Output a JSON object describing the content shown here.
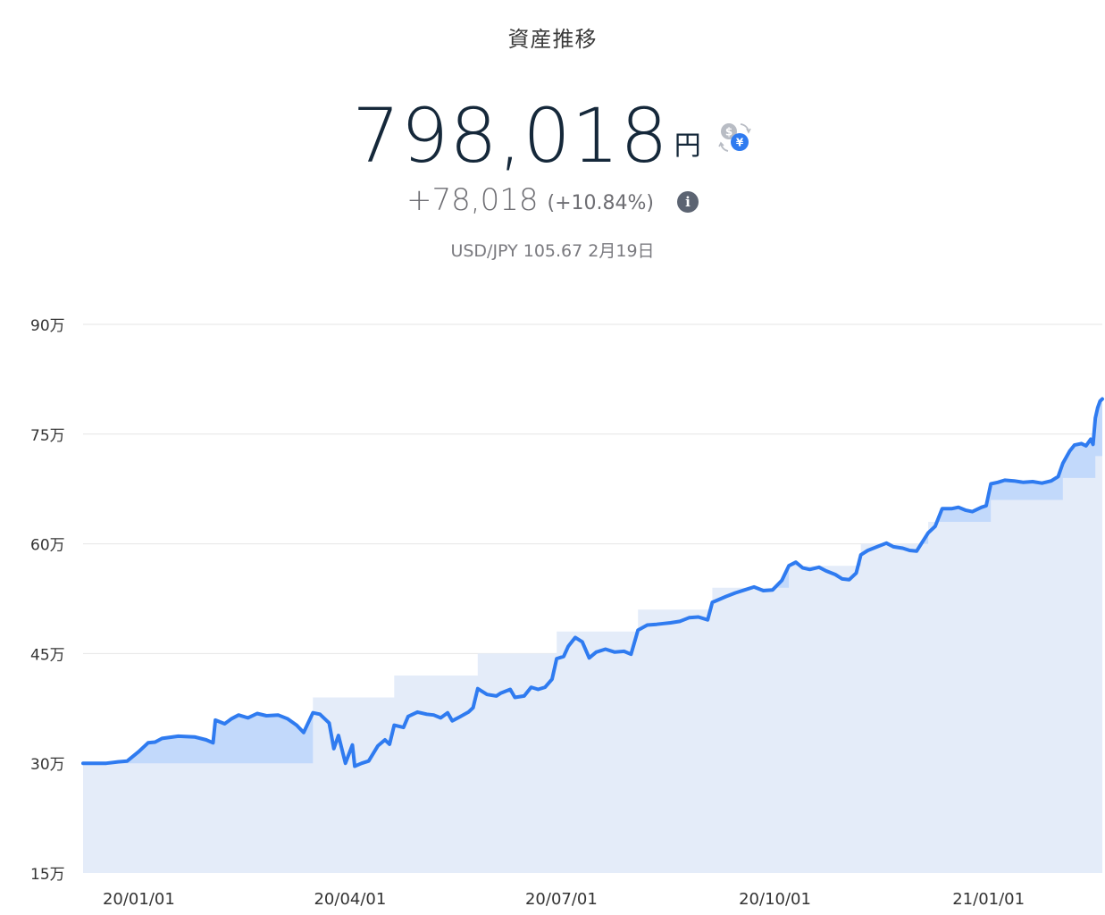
{
  "header": {
    "title": "資産推移",
    "total_value": "798,018",
    "total_unit": "円",
    "change_value": "+78,018",
    "change_percent": "(+10.84%)",
    "rate_text": "USD/JPY 105.67 2月19日",
    "currency_switch_symbols": [
      "$",
      "¥"
    ]
  },
  "colors": {
    "line": "#2f7bf0",
    "asset_fill": "#c2d9fb",
    "principal_fill": "#e4ecf9",
    "grid": "#e6e6e6"
  },
  "chart_data": {
    "type": "area",
    "y_unit": "万",
    "ylim": [
      15,
      90
    ],
    "y_ticks": [
      "15万",
      "30万",
      "45万",
      "60万",
      "75万",
      "90万"
    ],
    "y_tick_values": [
      15,
      30,
      45,
      60,
      75,
      90
    ],
    "x_ticks": [
      "20/01/01",
      "20/04/01",
      "20/07/01",
      "20/10/01",
      "21/01/01"
    ],
    "x_tick_dates": [
      "2020-01-01",
      "2020-04-01",
      "2020-07-01",
      "2020-10-01",
      "2021-01-01"
    ],
    "xlim": [
      "2019-12-08",
      "2021-02-19"
    ],
    "grid": true,
    "legend": "none",
    "series": [
      {
        "role": "asset",
        "points": [
          [
            "2019-12-08",
            30.0
          ],
          [
            "2019-12-18",
            30.0
          ],
          [
            "2019-12-23",
            30.2
          ],
          [
            "2019-12-27",
            30.3
          ],
          [
            "2020-01-01",
            31.6
          ],
          [
            "2020-01-05",
            32.8
          ],
          [
            "2020-01-08",
            32.9
          ],
          [
            "2020-01-11",
            33.4
          ],
          [
            "2020-01-18",
            33.7
          ],
          [
            "2020-01-25",
            33.6
          ],
          [
            "2020-01-30",
            33.2
          ],
          [
            "2020-02-02",
            32.8
          ],
          [
            "2020-02-03",
            35.9
          ],
          [
            "2020-02-07",
            35.4
          ],
          [
            "2020-02-10",
            36.1
          ],
          [
            "2020-02-13",
            36.6
          ],
          [
            "2020-02-17",
            36.2
          ],
          [
            "2020-02-21",
            36.8
          ],
          [
            "2020-02-25",
            36.5
          ],
          [
            "2020-03-01",
            36.6
          ],
          [
            "2020-03-05",
            36.1
          ],
          [
            "2020-03-09",
            35.2
          ],
          [
            "2020-03-12",
            34.2
          ],
          [
            "2020-03-16",
            36.9
          ],
          [
            "2020-03-19",
            36.7
          ],
          [
            "2020-03-23",
            35.5
          ],
          [
            "2020-03-25",
            32.0
          ],
          [
            "2020-03-27",
            33.8
          ],
          [
            "2020-03-30",
            30.0
          ],
          [
            "2020-04-02",
            32.5
          ],
          [
            "2020-04-03",
            29.6
          ],
          [
            "2020-04-06",
            30.0
          ],
          [
            "2020-04-09",
            30.3
          ],
          [
            "2020-04-13",
            32.4
          ],
          [
            "2020-04-16",
            33.2
          ],
          [
            "2020-04-18",
            32.6
          ],
          [
            "2020-04-20",
            35.2
          ],
          [
            "2020-04-24",
            34.9
          ],
          [
            "2020-04-26",
            36.4
          ],
          [
            "2020-04-30",
            37.0
          ],
          [
            "2020-05-04",
            36.7
          ],
          [
            "2020-05-07",
            36.6
          ],
          [
            "2020-05-10",
            36.2
          ],
          [
            "2020-05-13",
            36.9
          ],
          [
            "2020-05-15",
            35.8
          ],
          [
            "2020-05-18",
            36.3
          ],
          [
            "2020-05-22",
            37.0
          ],
          [
            "2020-05-24",
            37.6
          ],
          [
            "2020-05-26",
            40.2
          ],
          [
            "2020-05-30",
            39.4
          ],
          [
            "2020-06-03",
            39.2
          ],
          [
            "2020-06-05",
            39.6
          ],
          [
            "2020-06-09",
            40.1
          ],
          [
            "2020-06-11",
            39.0
          ],
          [
            "2020-06-15",
            39.2
          ],
          [
            "2020-06-18",
            40.4
          ],
          [
            "2020-06-21",
            40.1
          ],
          [
            "2020-06-24",
            40.4
          ],
          [
            "2020-06-27",
            41.5
          ],
          [
            "2020-06-29",
            44.3
          ],
          [
            "2020-07-02",
            44.6
          ],
          [
            "2020-07-04",
            46.0
          ],
          [
            "2020-07-07",
            47.2
          ],
          [
            "2020-07-10",
            46.6
          ],
          [
            "2020-07-13",
            44.4
          ],
          [
            "2020-07-16",
            45.2
          ],
          [
            "2020-07-20",
            45.6
          ],
          [
            "2020-07-24",
            45.2
          ],
          [
            "2020-07-28",
            45.3
          ],
          [
            "2020-07-31",
            44.9
          ],
          [
            "2020-08-03",
            48.2
          ],
          [
            "2020-08-07",
            48.9
          ],
          [
            "2020-08-11",
            49.0
          ],
          [
            "2020-08-14",
            49.1
          ],
          [
            "2020-08-17",
            49.2
          ],
          [
            "2020-08-21",
            49.4
          ],
          [
            "2020-08-25",
            49.9
          ],
          [
            "2020-08-29",
            50.0
          ],
          [
            "2020-09-02",
            49.6
          ],
          [
            "2020-09-04",
            52.0
          ],
          [
            "2020-09-10",
            52.8
          ],
          [
            "2020-09-14",
            53.3
          ],
          [
            "2020-09-18",
            53.7
          ],
          [
            "2020-09-22",
            54.1
          ],
          [
            "2020-09-26",
            53.6
          ],
          [
            "2020-09-30",
            53.7
          ],
          [
            "2020-10-04",
            55.0
          ],
          [
            "2020-10-07",
            57.0
          ],
          [
            "2020-10-10",
            57.5
          ],
          [
            "2020-10-13",
            56.7
          ],
          [
            "2020-10-16",
            56.5
          ],
          [
            "2020-10-20",
            56.8
          ],
          [
            "2020-10-23",
            56.3
          ],
          [
            "2020-10-27",
            55.8
          ],
          [
            "2020-10-30",
            55.2
          ],
          [
            "2020-11-02",
            55.1
          ],
          [
            "2020-11-05",
            56.0
          ],
          [
            "2020-11-07",
            58.5
          ],
          [
            "2020-11-10",
            59.1
          ],
          [
            "2020-11-14",
            59.6
          ],
          [
            "2020-11-18",
            60.1
          ],
          [
            "2020-11-21",
            59.6
          ],
          [
            "2020-11-25",
            59.4
          ],
          [
            "2020-11-28",
            59.1
          ],
          [
            "2020-12-01",
            59.0
          ],
          [
            "2020-12-03",
            60.0
          ],
          [
            "2020-12-06",
            61.5
          ],
          [
            "2020-12-09",
            62.4
          ],
          [
            "2020-12-12",
            64.8
          ],
          [
            "2020-12-16",
            64.8
          ],
          [
            "2020-12-19",
            65.0
          ],
          [
            "2020-12-22",
            64.6
          ],
          [
            "2020-12-25",
            64.4
          ],
          [
            "2020-12-29",
            65.0
          ],
          [
            "2020-12-31",
            65.2
          ],
          [
            "2021-01-02",
            68.2
          ],
          [
            "2021-01-05",
            68.4
          ],
          [
            "2021-01-08",
            68.7
          ],
          [
            "2021-01-12",
            68.6
          ],
          [
            "2021-01-16",
            68.4
          ],
          [
            "2021-01-20",
            68.5
          ],
          [
            "2021-01-24",
            68.3
          ],
          [
            "2021-01-28",
            68.6
          ],
          [
            "2021-01-31",
            69.2
          ],
          [
            "2021-02-02",
            71.0
          ],
          [
            "2021-02-05",
            72.7
          ],
          [
            "2021-02-07",
            73.5
          ],
          [
            "2021-02-10",
            73.7
          ],
          [
            "2021-02-12",
            73.4
          ],
          [
            "2021-02-14",
            74.3
          ],
          [
            "2021-02-15",
            73.6
          ],
          [
            "2021-02-16",
            77.2
          ],
          [
            "2021-02-17",
            78.6
          ],
          [
            "2021-02-18",
            79.5
          ],
          [
            "2021-02-19",
            79.8
          ]
        ]
      },
      {
        "role": "principal",
        "points": [
          [
            "2019-12-08",
            30.0
          ],
          [
            "2020-03-16",
            30.0
          ],
          [
            "2020-03-16",
            39.0
          ],
          [
            "2020-04-20",
            39.0
          ],
          [
            "2020-04-20",
            42.0
          ],
          [
            "2020-05-26",
            42.0
          ],
          [
            "2020-05-26",
            45.0
          ],
          [
            "2020-06-29",
            45.0
          ],
          [
            "2020-06-29",
            48.0
          ],
          [
            "2020-08-03",
            48.0
          ],
          [
            "2020-08-03",
            51.0
          ],
          [
            "2020-09-04",
            51.0
          ],
          [
            "2020-09-04",
            54.0
          ],
          [
            "2020-10-07",
            54.0
          ],
          [
            "2020-10-07",
            57.0
          ],
          [
            "2020-11-07",
            57.0
          ],
          [
            "2020-11-07",
            60.0
          ],
          [
            "2020-12-06",
            60.0
          ],
          [
            "2020-12-06",
            63.0
          ],
          [
            "2021-01-02",
            63.0
          ],
          [
            "2021-01-02",
            66.0
          ],
          [
            "2021-02-02",
            66.0
          ],
          [
            "2021-02-02",
            69.0
          ],
          [
            "2021-02-16",
            69.0
          ],
          [
            "2021-02-16",
            72.0
          ],
          [
            "2021-02-19",
            72.0
          ]
        ]
      }
    ]
  }
}
